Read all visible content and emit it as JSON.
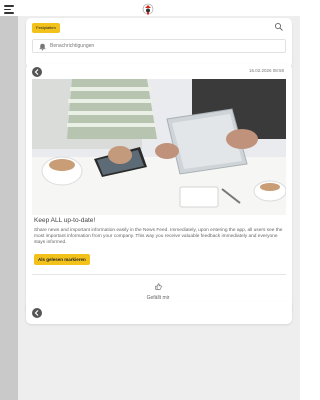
{
  "header": {
    "menu_icon": "hamburger-menu-icon",
    "logo_icon": "app-logo-icon"
  },
  "search": {
    "chip_label": "Festplatten",
    "search_icon": "search-icon",
    "subscription_label": "Benachrichtigungen",
    "bell_icon": "bell-icon"
  },
  "post": {
    "back_icon": "back-arrow-icon",
    "timestamp": "16.02.2026 08:58",
    "image_alt": "People working with tablet and notebook on desk",
    "title": "Keep ALL up-to-date!",
    "body": "Share news and important information easily in the News Feed. Immediately, upon entering the app, all users see the most important information from your company. This way you receive valuable feedback immediately and everyone stays informed.",
    "cta_label": "Als gelesen markieren",
    "like_icon": "thumbs-up-icon",
    "like_label": "Gefällt mir"
  },
  "next_post": {
    "back_icon": "back-arrow-icon"
  },
  "colors": {
    "accent": "#f2c21b",
    "sidebar": "#c9c9c9",
    "background": "#eeeeee"
  }
}
